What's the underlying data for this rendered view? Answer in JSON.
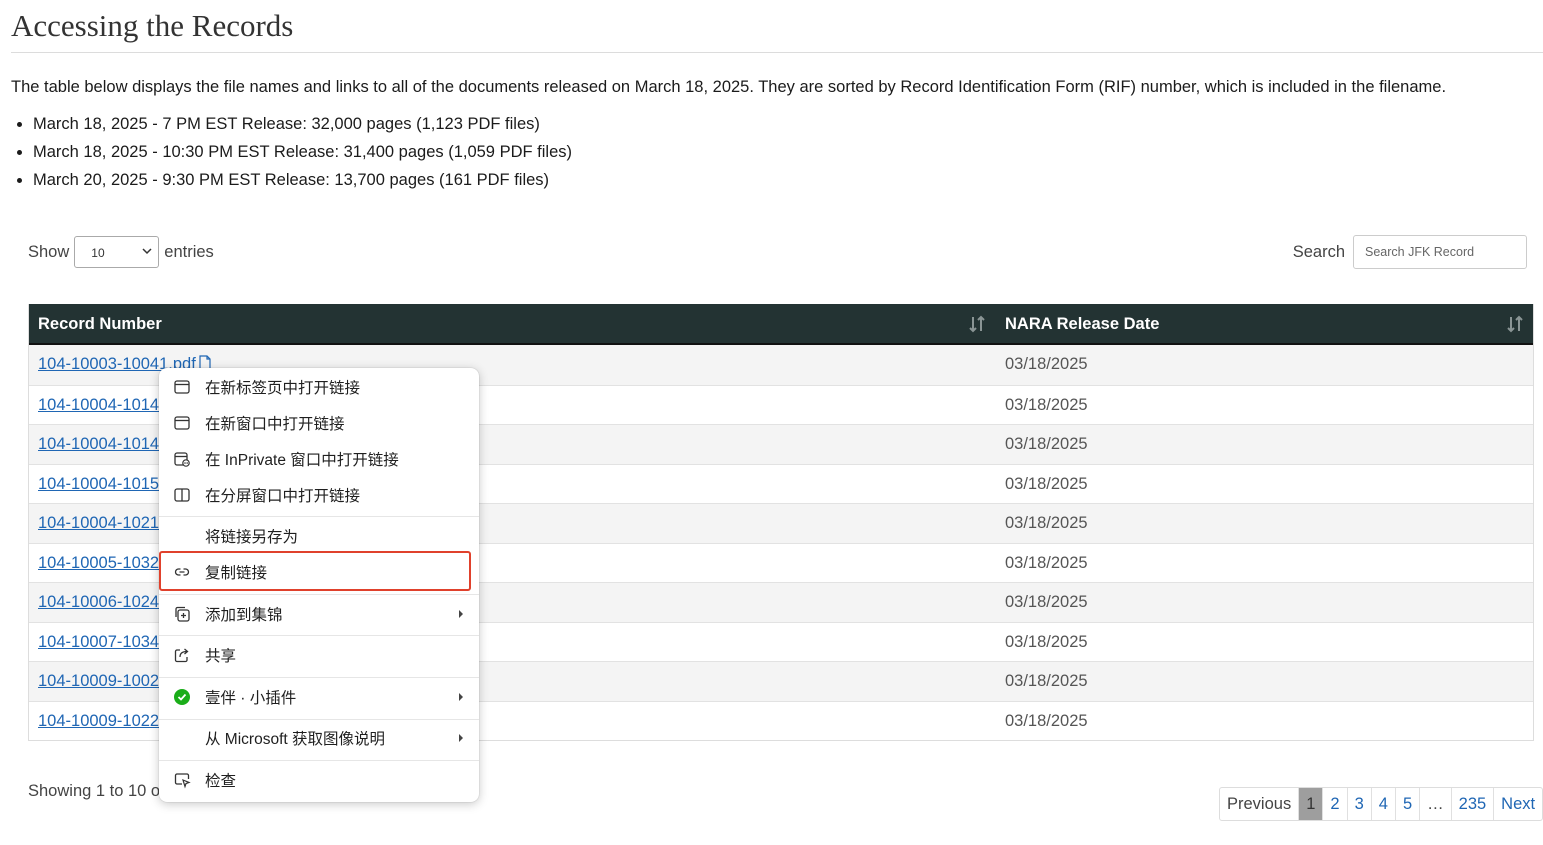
{
  "page": {
    "title": "Accessing the Records",
    "intro": "The table below displays the file names and links to all of the documents released on March 18, 2025.  They are sorted by Record Identification Form (RIF) number, which is included in the filename.",
    "releases": [
      "March 18, 2025 - 7 PM EST Release: 32,000 pages (1,123 PDF files)",
      "March 18, 2025 - 10:30 PM EST Release: 31,400 pages (1,059 PDF files)",
      "March 20, 2025 - 9:30 PM EST Release: 13,700 pages (161 PDF files)"
    ]
  },
  "controls": {
    "show_label": "Show",
    "entries_value": "10",
    "entries_label": "entries",
    "search_label": "Search",
    "search_placeholder": "Search JFK Record"
  },
  "table": {
    "headers": [
      "Record Number",
      "NARA Release Date"
    ],
    "rows": [
      {
        "record": "104-10003-10041.pdf",
        "date": "03/18/2025"
      },
      {
        "record": "104-10004-1014",
        "date": "03/18/2025"
      },
      {
        "record": "104-10004-1014",
        "date": "03/18/2025"
      },
      {
        "record": "104-10004-1015",
        "date": "03/18/2025"
      },
      {
        "record": "104-10004-1021",
        "date": "03/18/2025"
      },
      {
        "record": "104-10005-1032",
        "date": "03/18/2025"
      },
      {
        "record": "104-10006-1024",
        "date": "03/18/2025"
      },
      {
        "record": "104-10007-1034",
        "date": "03/18/2025"
      },
      {
        "record": "104-10009-1002",
        "date": "03/18/2025"
      },
      {
        "record": "104-10009-1022",
        "date": "03/18/2025"
      }
    ],
    "showing": "Showing 1 to 10 o"
  },
  "pagination": {
    "previous": "Previous",
    "pages": [
      "1",
      "2",
      "3",
      "4",
      "5"
    ],
    "current": "1",
    "ellipsis": "…",
    "last": "235",
    "next": "Next"
  },
  "context_menu": {
    "items": [
      {
        "label": "在新标签页中打开链接",
        "icon": "new-tab-icon"
      },
      {
        "label": "在新窗口中打开链接",
        "icon": "new-window-icon"
      },
      {
        "label": "在 InPrivate 窗口中打开链接",
        "icon": "inprivate-window-icon"
      },
      {
        "label": "在分屏窗口中打开链接",
        "icon": "split-screen-icon"
      },
      {
        "label": "将链接另存为",
        "icon": ""
      },
      {
        "label": "复制链接",
        "icon": "link-icon"
      },
      {
        "label": "添加到集锦",
        "icon": "collections-icon"
      },
      {
        "label": "共享",
        "icon": "share-icon"
      },
      {
        "label": "壹伴 · 小插件",
        "icon": "yiban-extension-icon"
      },
      {
        "label": "从 Microsoft 获取图像说明",
        "icon": ""
      },
      {
        "label": "检查",
        "icon": "inspect-icon"
      }
    ],
    "highlight_color": "#e0412c"
  },
  "colors": {
    "header_bg": "#233333",
    "link": "#1f66b4",
    "row_alt": "#f4f4f4",
    "extension_green": "#1aad19"
  }
}
